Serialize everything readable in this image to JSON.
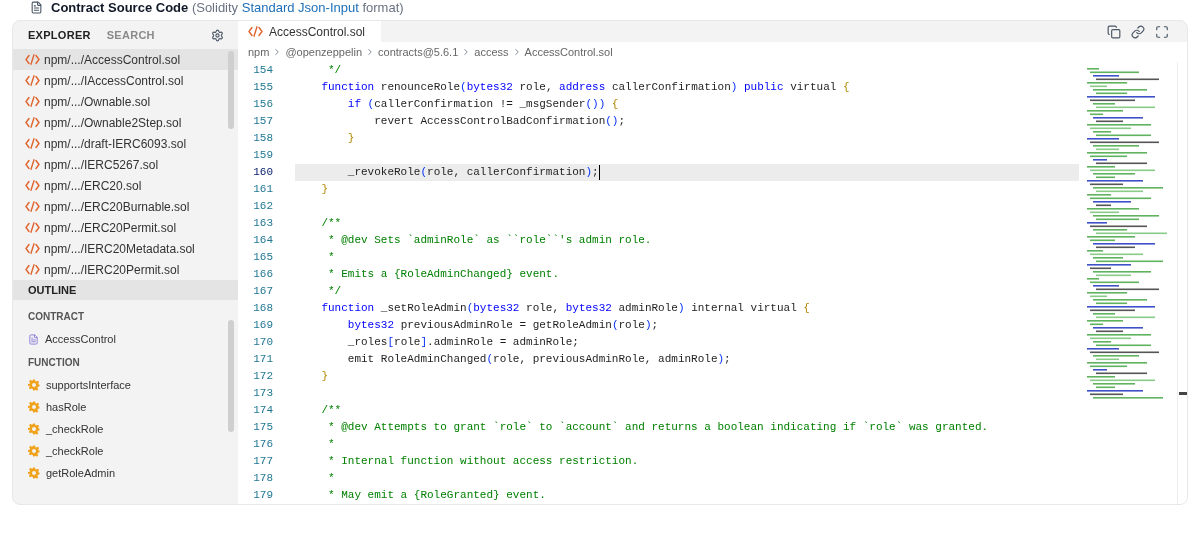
{
  "header": {
    "title": "Contract Source Code",
    "note_before": "(Solidity",
    "link": "Standard Json-Input",
    "note_after": "format)"
  },
  "sidebar": {
    "tabs": [
      {
        "label": "EXPLORER",
        "selected": true
      },
      {
        "label": "SEARCH",
        "selected": false
      }
    ],
    "files": [
      {
        "label": "npm/.../AccessControl.sol",
        "selected": true
      },
      {
        "label": "npm/.../IAccessControl.sol",
        "selected": false
      },
      {
        "label": "npm/.../Ownable.sol",
        "selected": false
      },
      {
        "label": "npm/.../Ownable2Step.sol",
        "selected": false
      },
      {
        "label": "npm/.../draft-IERC6093.sol",
        "selected": false
      },
      {
        "label": "npm/.../IERC5267.sol",
        "selected": false
      },
      {
        "label": "npm/.../ERC20.sol",
        "selected": false
      },
      {
        "label": "npm/.../ERC20Burnable.sol",
        "selected": false
      },
      {
        "label": "npm/.../ERC20Permit.sol",
        "selected": false
      },
      {
        "label": "npm/.../IERC20Metadata.sol",
        "selected": false
      },
      {
        "label": "npm/.../IERC20Permit.sol",
        "selected": false
      }
    ],
    "outline": {
      "title": "OUTLINE",
      "groups": [
        {
          "label": "CONTRACT",
          "kind": "contract",
          "items": [
            "AccessControl"
          ]
        },
        {
          "label": "FUNCTION",
          "kind": "function",
          "items": [
            "supportsInterface",
            "hasRole",
            "_checkRole",
            "_checkRole",
            "getRoleAdmin"
          ]
        }
      ]
    }
  },
  "editor": {
    "tabs": [
      {
        "label": "AccessControl.sol",
        "selected": true
      }
    ],
    "breadcrumb": [
      "npm",
      "@openzeppelin",
      "contracts@5.6.1",
      "access",
      "AccessControl.sol"
    ],
    "lines": [
      {
        "number": "154",
        "active": false,
        "segments": [
          {
            "kind": "comment",
            "text": "     */"
          }
        ]
      },
      {
        "number": "155",
        "active": false,
        "segments": [
          {
            "kind": "keyword",
            "text": "    function"
          },
          {
            "kind": "plain",
            "text": " renounceRole"
          },
          {
            "kind": "paren",
            "text": "("
          },
          {
            "kind": "keyword",
            "text": "bytes32"
          },
          {
            "kind": "plain",
            "text": " role, "
          },
          {
            "kind": "keyword",
            "text": "address"
          },
          {
            "kind": "plain",
            "text": " callerConfirmation"
          },
          {
            "kind": "paren",
            "text": ")"
          },
          {
            "kind": "keyword",
            "text": " public"
          },
          {
            "kind": "plain",
            "text": " virtual "
          },
          {
            "kind": "bracket",
            "text": "{"
          }
        ]
      },
      {
        "number": "156",
        "active": false,
        "segments": [
          {
            "kind": "keyword",
            "text": "        if"
          },
          {
            "kind": "paren",
            "text": " ("
          },
          {
            "kind": "plain",
            "text": "callerConfirmation != _msgSender"
          },
          {
            "kind": "paren",
            "text": "())"
          },
          {
            "kind": "bracket",
            "text": " {"
          }
        ]
      },
      {
        "number": "157",
        "active": false,
        "segments": [
          {
            "kind": "plain",
            "text": "            revert AccessControlBadConfirmation"
          },
          {
            "kind": "paren",
            "text": "()"
          },
          {
            "kind": "plain",
            "text": ";"
          }
        ]
      },
      {
        "number": "158",
        "active": false,
        "segments": [
          {
            "kind": "bracket",
            "text": "        }"
          }
        ]
      },
      {
        "number": "159",
        "active": false
      },
      {
        "number": "160",
        "active": true,
        "segments": [
          {
            "kind": "plain",
            "text": "        _revokeRole"
          },
          {
            "kind": "paren",
            "text": "("
          },
          {
            "kind": "plain",
            "text": "role, callerConfirmation"
          },
          {
            "kind": "paren",
            "text": ")"
          },
          {
            "kind": "plain",
            "text": ";"
          }
        ]
      },
      {
        "number": "161",
        "active": false,
        "segments": [
          {
            "kind": "bracket",
            "text": "    }"
          }
        ]
      },
      {
        "number": "162",
        "active": false
      },
      {
        "number": "163",
        "active": false,
        "segments": [
          {
            "kind": "comment",
            "text": "    /**"
          }
        ]
      },
      {
        "number": "164",
        "active": false,
        "segments": [
          {
            "kind": "comment",
            "text": "     * @dev Sets `adminRole` as ``role``'s admin role."
          }
        ]
      },
      {
        "number": "165",
        "active": false,
        "segments": [
          {
            "kind": "comment",
            "text": "     *"
          }
        ]
      },
      {
        "number": "166",
        "active": false,
        "segments": [
          {
            "kind": "comment",
            "text": "     * Emits a {RoleAdminChanged} event."
          }
        ]
      },
      {
        "number": "167",
        "active": false,
        "segments": [
          {
            "kind": "comment",
            "text": "     */"
          }
        ]
      },
      {
        "number": "168",
        "active": false,
        "segments": [
          {
            "kind": "keyword",
            "text": "    function"
          },
          {
            "kind": "plain",
            "text": " _setRoleAdmin"
          },
          {
            "kind": "paren",
            "text": "("
          },
          {
            "kind": "keyword",
            "text": "bytes32"
          },
          {
            "kind": "plain",
            "text": " role, "
          },
          {
            "kind": "keyword",
            "text": "bytes32"
          },
          {
            "kind": "plain",
            "text": " adminRole"
          },
          {
            "kind": "paren",
            "text": ")"
          },
          {
            "kind": "plain",
            "text": " internal virtual "
          },
          {
            "kind": "bracket",
            "text": "{"
          }
        ]
      },
      {
        "number": "169",
        "active": false,
        "segments": [
          {
            "kind": "keyword",
            "text": "        bytes32"
          },
          {
            "kind": "plain",
            "text": " previousAdminRole = getRoleAdmin"
          },
          {
            "kind": "paren",
            "text": "("
          },
          {
            "kind": "plain",
            "text": "role"
          },
          {
            "kind": "paren",
            "text": ")"
          },
          {
            "kind": "plain",
            "text": ";"
          }
        ]
      },
      {
        "number": "170",
        "active": false,
        "segments": [
          {
            "kind": "plain",
            "text": "        _roles"
          },
          {
            "kind": "paren",
            "text": "["
          },
          {
            "kind": "plain",
            "text": "role"
          },
          {
            "kind": "paren",
            "text": "]"
          },
          {
            "kind": "plain",
            "text": ".adminRole = adminRole;"
          }
        ]
      },
      {
        "number": "171",
        "active": false,
        "segments": [
          {
            "kind": "plain",
            "text": "        emit RoleAdminChanged"
          },
          {
            "kind": "paren",
            "text": "("
          },
          {
            "kind": "plain",
            "text": "role, previousAdminRole, adminRole"
          },
          {
            "kind": "paren",
            "text": ")"
          },
          {
            "kind": "plain",
            "text": ";"
          }
        ]
      },
      {
        "number": "172",
        "active": false,
        "segments": [
          {
            "kind": "bracket",
            "text": "    }"
          }
        ]
      },
      {
        "number": "173",
        "active": false
      },
      {
        "number": "174",
        "active": false,
        "segments": [
          {
            "kind": "comment",
            "text": "    /**"
          }
        ]
      },
      {
        "number": "175",
        "active": false,
        "segments": [
          {
            "kind": "comment",
            "text": "     * @dev Attempts to grant `role` to `account` and returns a boolean indicating if `role` was granted."
          }
        ]
      },
      {
        "number": "176",
        "active": false,
        "segments": [
          {
            "kind": "comment",
            "text": "     *"
          }
        ]
      },
      {
        "number": "177",
        "active": false,
        "segments": [
          {
            "kind": "comment",
            "text": "     * Internal function without access restriction."
          }
        ]
      },
      {
        "number": "178",
        "active": false,
        "segments": [
          {
            "kind": "comment",
            "text": "     *"
          }
        ]
      },
      {
        "number": "179",
        "active": false,
        "segments": [
          {
            "kind": "comment",
            "text": "     * May emit a {RoleGranted} event."
          }
        ]
      }
    ]
  }
}
